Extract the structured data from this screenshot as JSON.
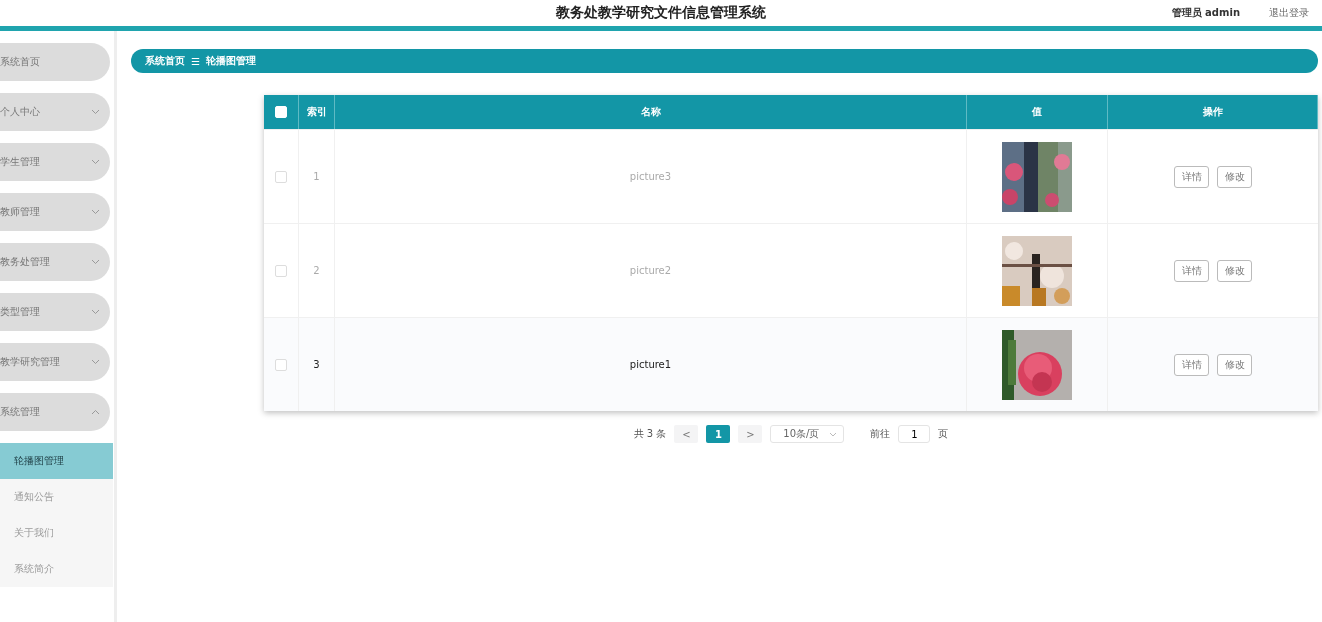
{
  "header": {
    "title": "教务处教学研究文件信息管理系统",
    "user": "管理员 admin",
    "logout": "退出登录"
  },
  "sidebar": {
    "items": [
      {
        "label": "系统首页",
        "kind": "link"
      },
      {
        "label": "个人中心",
        "kind": "menu",
        "expanded": false
      },
      {
        "label": "学生管理",
        "kind": "menu",
        "expanded": false
      },
      {
        "label": "教师管理",
        "kind": "menu",
        "expanded": false
      },
      {
        "label": "教务处管理",
        "kind": "menu",
        "expanded": false
      },
      {
        "label": "类型管理",
        "kind": "menu",
        "expanded": false
      },
      {
        "label": "教学研究管理",
        "kind": "menu",
        "expanded": false
      },
      {
        "label": "系统管理",
        "kind": "menu",
        "expanded": true,
        "children": [
          {
            "label": "轮播图管理",
            "selected": true
          },
          {
            "label": "通知公告",
            "selected": false
          },
          {
            "label": "关于我们",
            "selected": false
          },
          {
            "label": "系统简介",
            "selected": false
          }
        ]
      }
    ]
  },
  "breadcrumb": {
    "home": "系统首页",
    "separator": "☰",
    "current": "轮播图管理"
  },
  "table": {
    "select_all_checked": false,
    "columns": [
      "索引",
      "名称",
      "值",
      "操作"
    ],
    "rows": [
      {
        "index": "1",
        "name": "picture3",
        "highlighted": false,
        "checked": false,
        "actions": [
          "详情",
          "修改"
        ]
      },
      {
        "index": "2",
        "name": "picture2",
        "highlighted": false,
        "checked": false,
        "actions": [
          "详情",
          "修改"
        ]
      },
      {
        "index": "3",
        "name": "picture1",
        "highlighted": true,
        "checked": false,
        "actions": [
          "详情",
          "修改"
        ]
      }
    ]
  },
  "pagination": {
    "total": "共 3 条",
    "prev": "<",
    "pages": [
      {
        "label": "1",
        "selected": true
      }
    ],
    "next": ">",
    "page_size": "10条/页",
    "goto_label": "前往",
    "goto_value": "1",
    "goto_suffix": "页"
  }
}
